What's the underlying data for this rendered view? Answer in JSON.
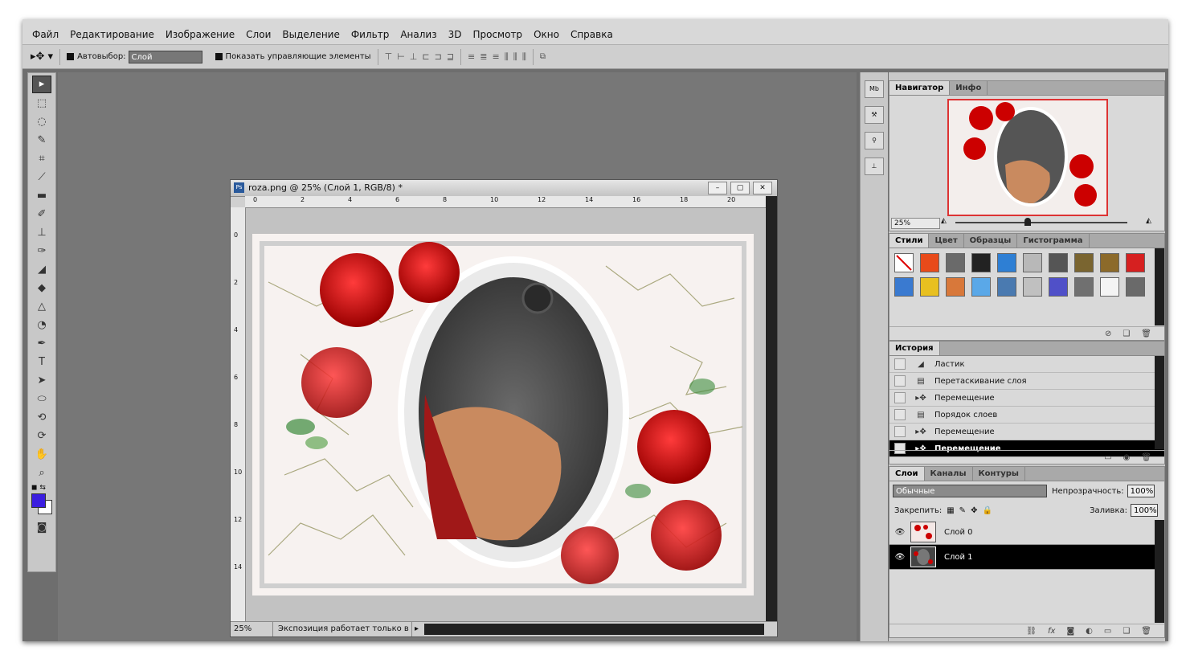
{
  "menu": [
    "Файл",
    "Редактирование",
    "Изображение",
    "Слои",
    "Выделение",
    "Фильтр",
    "Анализ",
    "3D",
    "Просмотр",
    "Окно",
    "Справка"
  ],
  "options": {
    "auto_select_label": "Автовыбор:",
    "auto_select_value": "Слой",
    "show_controls_label": "Показать управляющие элементы"
  },
  "document": {
    "title": "roza.png @ 25% (Слой 1, RGB/8) *",
    "ruler_h": [
      "0",
      "2",
      "4",
      "6",
      "8",
      "10",
      "12",
      "14",
      "16",
      "18",
      "20"
    ],
    "ruler_v": [
      "0",
      "2",
      "4",
      "6",
      "8",
      "10",
      "12",
      "14"
    ],
    "status_zoom": "25%",
    "status_info": "Экспозиция работает только в ..."
  },
  "navigator": {
    "tabs": [
      "Навигатор",
      "Инфо"
    ],
    "zoom": "25%"
  },
  "styles_panel": {
    "tabs": [
      "Стили",
      "Цвет",
      "Образцы",
      "Гистограмма"
    ],
    "swatches": [
      "#ffffff",
      "#e84a1a",
      "#6a6a6a",
      "#222222",
      "#2e7fd4",
      "#b8b8b8",
      "#555555",
      "#7a6530",
      "#8c6a2a",
      "#d62020",
      "#3a7ad0",
      "#e8c020",
      "#d8783a",
      "#5aa8e8",
      "#4a7ab0",
      "#c0c0c0",
      "#5050c8",
      "#707070",
      "#f4f4f4",
      "#6a6a6a"
    ]
  },
  "history": {
    "tab": "История",
    "items": [
      "Ластик",
      "Перетаскивание слоя",
      "Перемещение",
      "Порядок слоев",
      "Перемещение",
      "Перемещение"
    ]
  },
  "layers": {
    "tabs": [
      "Слои",
      "Каналы",
      "Контуры"
    ],
    "blend_mode": "Обычные",
    "opacity_label": "Непрозрачность:",
    "opacity_value": "100%",
    "lock_label": "Закрепить:",
    "fill_label": "Заливка:",
    "fill_value": "100%",
    "items": [
      "Слой 0",
      "Слой 1"
    ]
  },
  "colors": {
    "foreground": "#3b1ee0",
    "background": "#ffffff"
  }
}
